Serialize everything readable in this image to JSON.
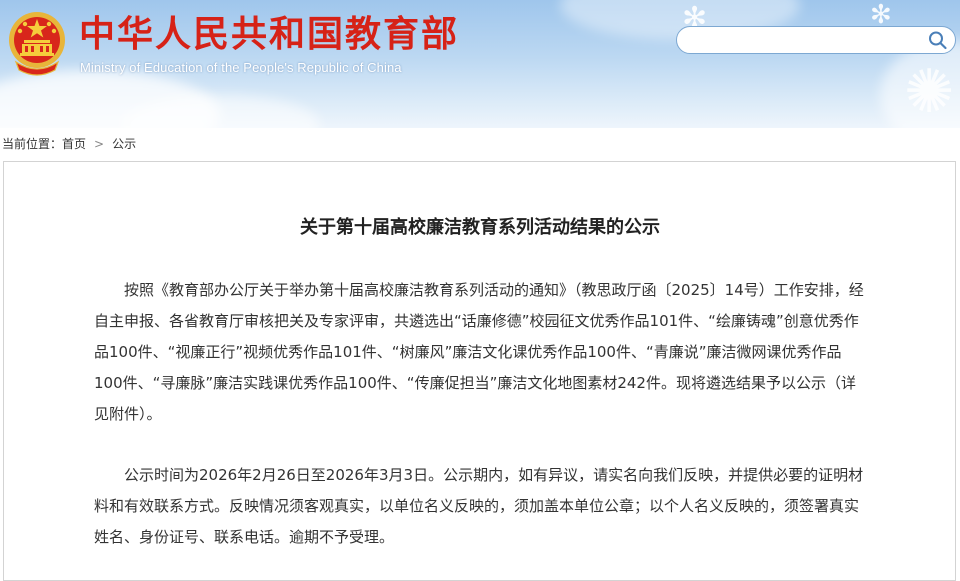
{
  "header": {
    "title": "中华人民共和国教育部",
    "subtitle": "Ministry of Education of the People's Republic of China",
    "emblem_icon": "national-emblem-icon",
    "colors": {
      "title_red": "#d62217",
      "sky_top": "#9fc6ec",
      "sky_bottom": "#eef5fc"
    }
  },
  "search": {
    "placeholder": "",
    "value": "",
    "icon": "search-icon"
  },
  "breadcrumb": {
    "prefix": "当前位置：",
    "home": "首页",
    "separator": ">",
    "current": "公示"
  },
  "article": {
    "title": "关于第十届高校廉洁教育系列活动结果的公示",
    "paragraphs": [
      "按照《教育部办公厅关于举办第十届高校廉洁教育系列活动的通知》（教思政厅函〔2025〕14号）工作安排，经自主申报、各省教育厅审核把关及专家评审，共遴选出“话廉修德”校园征文优秀作品101件、“绘廉铸魂”创意优秀作品100件、“视廉正行”视频优秀作品101件、“树廉风”廉洁文化课优秀作品100件、“青廉说”廉洁微网课优秀作品100件、“寻廉脉”廉洁实践课优秀作品100件、“传廉促担当”廉洁文化地图素材242件。现将遴选结果予以公示（详见附件）。",
      "公示时间为2026年2月26日至2026年3月3日。公示期内，如有异议，请实名向我们反映，并提供必要的证明材料和有效联系方式。反映情况须客观真实，以单位名义反映的，须加盖本单位公章；以个人名义反映的，须签署真实姓名、身份证号、联系电话。逾期不予受理。"
    ]
  }
}
